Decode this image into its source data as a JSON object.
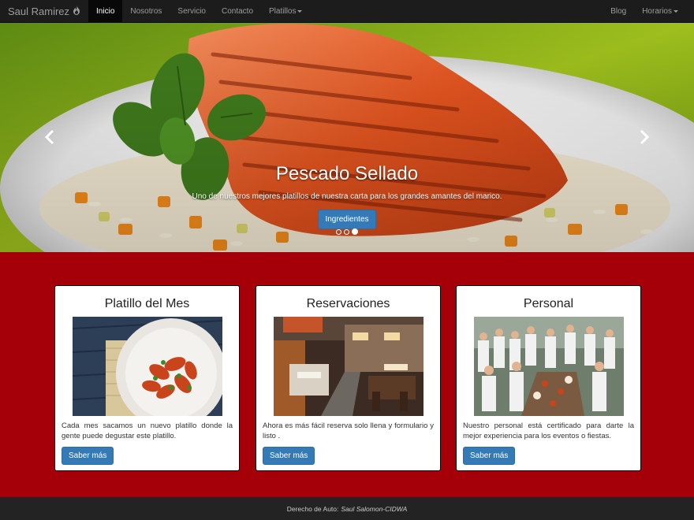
{
  "navbar": {
    "brand": "Saul Ramirez",
    "brand_icon": "flame-icon",
    "items": [
      {
        "label": "Inicio",
        "active": true
      },
      {
        "label": "Nosotros"
      },
      {
        "label": "Servicio"
      },
      {
        "label": "Contacto"
      },
      {
        "label": "Platillos",
        "dropdown": true
      }
    ],
    "right_items": [
      {
        "label": "Blog"
      },
      {
        "label": "Horarios",
        "dropdown": true
      }
    ]
  },
  "carousel": {
    "title": "Pescado Sellado",
    "subtitle": "Uno de nuestros mejores platillos de nuestra carta para los grandes amantes del marico.",
    "button": "Ingredientes",
    "prev_icon": "chevron-left-icon",
    "next_icon": "chevron-right-icon",
    "active_slide": 3,
    "slide_count": 3
  },
  "cards": [
    {
      "title": "Platillo del Mes",
      "text": "Cada mes sacamos un nuevo platillo donde la gente puede degustar este platillo.",
      "button": "Saber más"
    },
    {
      "title": "Reservaciones",
      "text": "Ahora es más fácil reserva solo llena y formulario y listo .",
      "button": "Saber más"
    },
    {
      "title": "Personal",
      "text": "Nuestro personal está certificado para darte la mejor experiencia para los eventos o fiestas.",
      "button": "Saber más"
    }
  ],
  "footer": {
    "prefix": "Derecho de Auto:",
    "author": "Saul Salomon-CIDWA"
  },
  "colors": {
    "navbar": "#1c1c1c",
    "page_background": "#a50009",
    "primary_button": "#337ab7",
    "footer": "#232323"
  }
}
